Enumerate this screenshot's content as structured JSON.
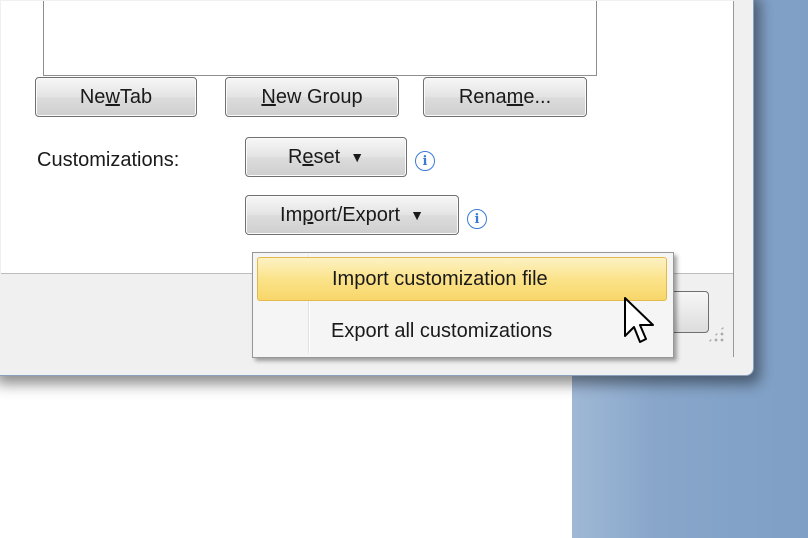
{
  "dialog": {
    "buttons": {
      "new_tab": {
        "pre": "Ne",
        "u": "w",
        "post": " Tab"
      },
      "new_group": {
        "pre": "",
        "u": "N",
        "post": "ew Group"
      },
      "rename": {
        "pre": "Rena",
        "u": "m",
        "post": "e..."
      }
    },
    "customizations_label": "Customizations:",
    "reset_button": {
      "pre": "R",
      "u": "e",
      "post": "set"
    },
    "import_export_button": {
      "pre": "Im",
      "u": "p",
      "post": "ort/Export"
    },
    "info_icon_glyph": "i"
  },
  "menu": {
    "items": [
      {
        "label": "Import customization file",
        "highlighted": true
      },
      {
        "label": "Export all customizations",
        "highlighted": false
      }
    ]
  },
  "colors": {
    "desktop_blue": "#88a6ca",
    "menu_highlight": "#fbe38a",
    "info_blue": "#3b7bd8"
  }
}
